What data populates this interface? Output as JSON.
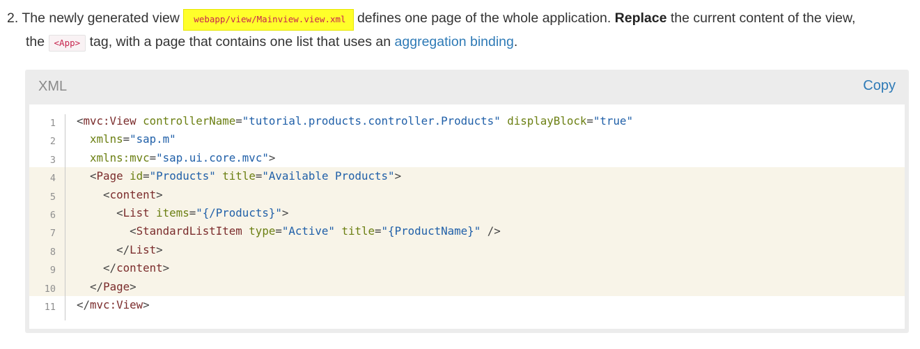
{
  "step": {
    "number": "2.",
    "text_1": " The newly generated view ",
    "file_path": "webapp/view/Mainview.view.xml",
    "text_2": " defines one page of the whole application. ",
    "bold": "Replace",
    "text_3": " the current content of the view,",
    "text_4": "the ",
    "inline_code": "<App>",
    "text_5": " tag, with a page that contains one list that uses an ",
    "link": "aggregation binding",
    "text_6": "."
  },
  "code_block": {
    "language": "XML",
    "copy_label": "Copy",
    "highlight_lines": [
      4,
      5,
      6,
      7,
      8,
      9,
      10
    ],
    "lines": [
      {
        "n": "1",
        "indent": "",
        "parts": [
          [
            "p",
            "<"
          ],
          [
            "t",
            "mvc:View"
          ],
          [
            "p",
            " "
          ],
          [
            "a",
            "controllerName"
          ],
          [
            "p",
            "="
          ],
          [
            "v",
            "\"tutorial.products.controller.Products\""
          ],
          [
            "p",
            " "
          ],
          [
            "a",
            "displayBlock"
          ],
          [
            "p",
            "="
          ],
          [
            "v",
            "\"true\""
          ]
        ]
      },
      {
        "n": "2",
        "indent": "  ",
        "parts": [
          [
            "a",
            "xmlns"
          ],
          [
            "p",
            "="
          ],
          [
            "v",
            "\"sap.m\""
          ]
        ]
      },
      {
        "n": "3",
        "indent": "  ",
        "parts": [
          [
            "a",
            "xmlns:mvc"
          ],
          [
            "p",
            "="
          ],
          [
            "v",
            "\"sap.ui.core.mvc\""
          ],
          [
            "p",
            ">"
          ]
        ]
      },
      {
        "n": "4",
        "indent": "  ",
        "parts": [
          [
            "p",
            "<"
          ],
          [
            "t",
            "Page"
          ],
          [
            "p",
            " "
          ],
          [
            "a",
            "id"
          ],
          [
            "p",
            "="
          ],
          [
            "v",
            "\"Products\""
          ],
          [
            "p",
            " "
          ],
          [
            "a",
            "title"
          ],
          [
            "p",
            "="
          ],
          [
            "v",
            "\"Available Products\""
          ],
          [
            "p",
            ">"
          ]
        ]
      },
      {
        "n": "5",
        "indent": "    ",
        "parts": [
          [
            "p",
            "<"
          ],
          [
            "t",
            "content"
          ],
          [
            "p",
            ">"
          ]
        ]
      },
      {
        "n": "6",
        "indent": "      ",
        "parts": [
          [
            "p",
            "<"
          ],
          [
            "t",
            "List"
          ],
          [
            "p",
            " "
          ],
          [
            "a",
            "items"
          ],
          [
            "p",
            "="
          ],
          [
            "v",
            "\"{/Products}\""
          ],
          [
            "p",
            ">"
          ]
        ]
      },
      {
        "n": "7",
        "indent": "        ",
        "parts": [
          [
            "p",
            "<"
          ],
          [
            "t",
            "StandardListItem"
          ],
          [
            "p",
            " "
          ],
          [
            "a",
            "type"
          ],
          [
            "p",
            "="
          ],
          [
            "v",
            "\"Active\""
          ],
          [
            "p",
            " "
          ],
          [
            "a",
            "title"
          ],
          [
            "p",
            "="
          ],
          [
            "v",
            "\"{ProductName}\""
          ],
          [
            "p",
            " />"
          ]
        ]
      },
      {
        "n": "8",
        "indent": "      ",
        "parts": [
          [
            "p",
            "</"
          ],
          [
            "t",
            "List"
          ],
          [
            "p",
            ">"
          ]
        ]
      },
      {
        "n": "9",
        "indent": "    ",
        "parts": [
          [
            "p",
            "</"
          ],
          [
            "t",
            "content"
          ],
          [
            "p",
            ">"
          ]
        ]
      },
      {
        "n": "10",
        "indent": "  ",
        "parts": [
          [
            "p",
            "</"
          ],
          [
            "t",
            "Page"
          ],
          [
            "p",
            ">"
          ]
        ]
      },
      {
        "n": "11",
        "indent": "",
        "parts": [
          [
            "p",
            "</"
          ],
          [
            "t",
            "mvc:View"
          ],
          [
            "p",
            ">"
          ]
        ]
      }
    ]
  }
}
